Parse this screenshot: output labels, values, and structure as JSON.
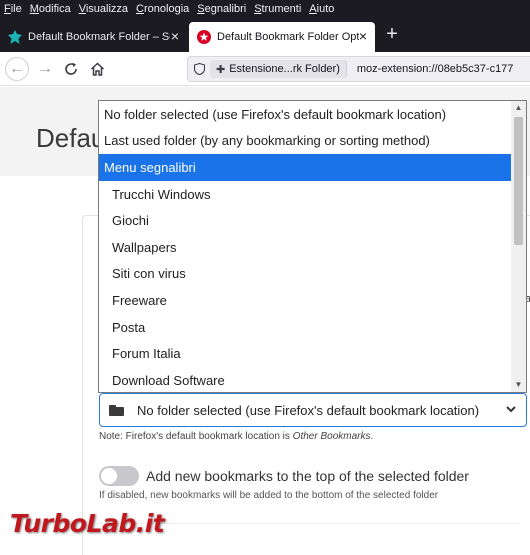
{
  "menubar": [
    "File",
    "Modifica",
    "Visualizza",
    "Cronologia",
    "Segnalibri",
    "Strumenti",
    "Aiuto"
  ],
  "tabs": [
    {
      "title": "Default Bookmark Folder – Scar"
    },
    {
      "title": "Default Bookmark Folder Optio"
    }
  ],
  "urlbar": {
    "identity": "Estensione...rk Folder)",
    "url": "moz-extension://08eb5c37-c177"
  },
  "page": {
    "title": "Default",
    "select_value": "No folder selected (use Firefox's default bookmark location)",
    "note_prefix": "Note: Firefox's default bookmark location is ",
    "note_emph": "Other Bookmarks",
    "note_suffix": ".",
    "toggle_label": "Add new bookmarks to the top of the selected folder",
    "toggle_on": false,
    "help_text": "If disabled, new bookmarks will be added to the bottom of the selected folder",
    "edge_fragments": [
      "l",
      "a"
    ]
  },
  "dropdown": {
    "options": [
      {
        "label": "No folder selected (use Firefox's default bookmark location)",
        "indent": false,
        "selected": false
      },
      {
        "label": "Last used folder (by any bookmarking or sorting method)",
        "indent": false,
        "selected": false
      },
      {
        "label": "Menu segnalibri",
        "indent": false,
        "selected": true
      },
      {
        "label": "Trucchi Windows",
        "indent": true,
        "selected": false
      },
      {
        "label": "Giochi",
        "indent": true,
        "selected": false
      },
      {
        "label": "Wallpapers",
        "indent": true,
        "selected": false
      },
      {
        "label": "Siti con virus",
        "indent": true,
        "selected": false
      },
      {
        "label": "Freeware",
        "indent": true,
        "selected": false
      },
      {
        "label": "Posta",
        "indent": true,
        "selected": false
      },
      {
        "label": "Forum Italia",
        "indent": true,
        "selected": false
      },
      {
        "label": "Download Software",
        "indent": true,
        "selected": false
      }
    ]
  },
  "watermark": "TurboLab.it",
  "colors": {
    "accent": "#1a73e8",
    "chrome": "#1c1b22",
    "watermark": "#c0181e"
  }
}
